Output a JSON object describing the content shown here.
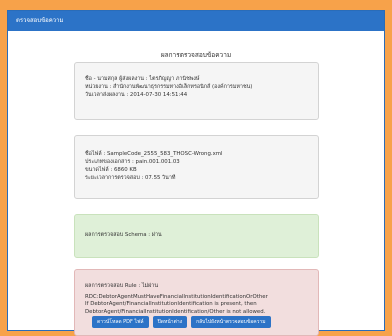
{
  "dialog": {
    "title": "ตรวจสอบข้อความ"
  },
  "main": {
    "heading": "ผลการตรวจสอบข้อความ"
  },
  "sender_panel": {
    "name_line": "ชื่อ - นามสกุล ผู้ส่งผลงาน : ไตรภิญญา ภานิชพงษ์",
    "agency_line": "หน่วยงาน : สำนักงานพัฒนาธุรกรรมทางอิเล็กทรอนิกส์ (องค์การมหาชน)",
    "time_line": "วันเวลาส่งผลงาน : 2014-07-30 14:51:44"
  },
  "file_panel": {
    "filename_line": "ชื่อไฟล์ : SampleCode_2555_583_THOSC-Wrong.xml",
    "type_line": "ประเภทของเอกสาร : pain.001.001.03",
    "size_line": "ขนาดไฟล์ : 6860 KB",
    "duration_line": "ระยะเวลาการตรวจสอบ : 07.55 วินาที"
  },
  "schema_panel": {
    "result_line": "ผลการตรวจสอบ Schema : ผ่าน"
  },
  "rule_panel": {
    "result_line": "ผลการตรวจสอบ Rule : ไม่ผ่าน",
    "error_code": "RDC:DebtorAgentMustHaveFinancialInstitutionIdentificationOrOther",
    "error_message": "If DebtorAgent/FinancialInstitutionIdentification is present, then DebtorAgent/FinancialInstitutionIdentification/Other is not allowed."
  },
  "buttons": {
    "export_pdf": "ดาวน์โหลด PDF ไฟล์",
    "close": "ปิดหน้าต่าง",
    "back": "กลับไปยังหน้าตรวจสอบข้อความ"
  },
  "colors": {
    "page_background": "#f7a24a",
    "title_bar": "#2c73c7",
    "success_panel": "#dff0d8",
    "error_panel": "#f2dede",
    "button": "#2c73c7"
  }
}
